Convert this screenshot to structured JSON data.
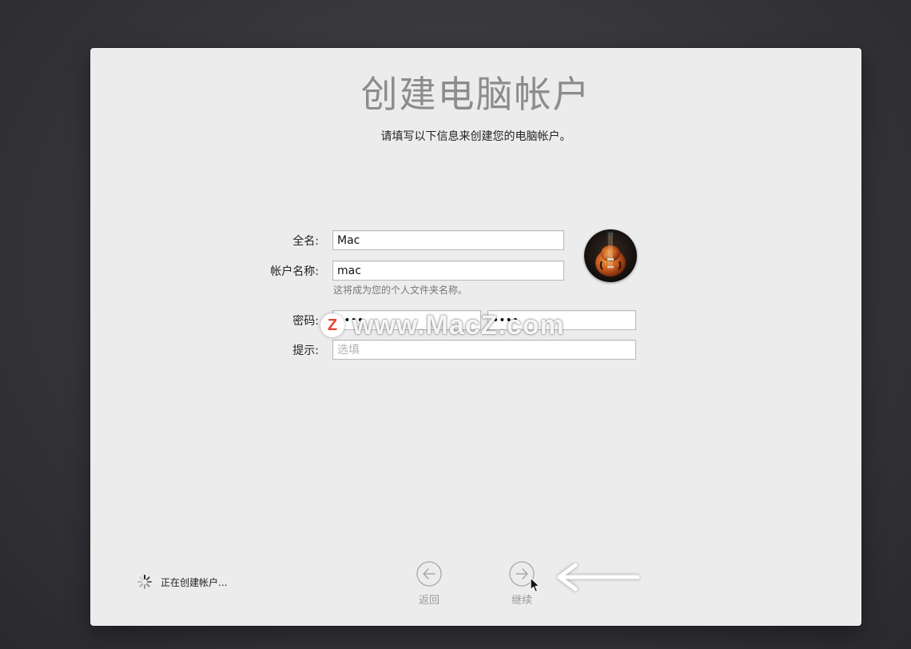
{
  "window": {
    "title": "创建电脑帐户",
    "subtitle": "请填写以下信息来创建您的电脑帐户。"
  },
  "form": {
    "full_name_label": "全名:",
    "full_name_value": "Mac",
    "account_name_label": "帐户名称:",
    "account_name_value": "mac",
    "account_name_helper": "这将成为您的个人文件夹名称。",
    "password_label": "密码:",
    "password_value": "••••",
    "verify_value": "••••",
    "hint_label": "提示:",
    "hint_placeholder": "选填"
  },
  "avatar": {
    "icon": "guitar-avatar-icon"
  },
  "footer": {
    "status_text": "正在创建帐户...",
    "back_label": "返回",
    "continue_label": "继续"
  },
  "watermark": {
    "logo_letter": "Z",
    "text": "www.MacZ.com"
  },
  "colors": {
    "window_bg": "#ececec",
    "desktop_bg": "#35353a",
    "title_color": "#8c8c8c",
    "watermark_red": "#e8432e"
  }
}
